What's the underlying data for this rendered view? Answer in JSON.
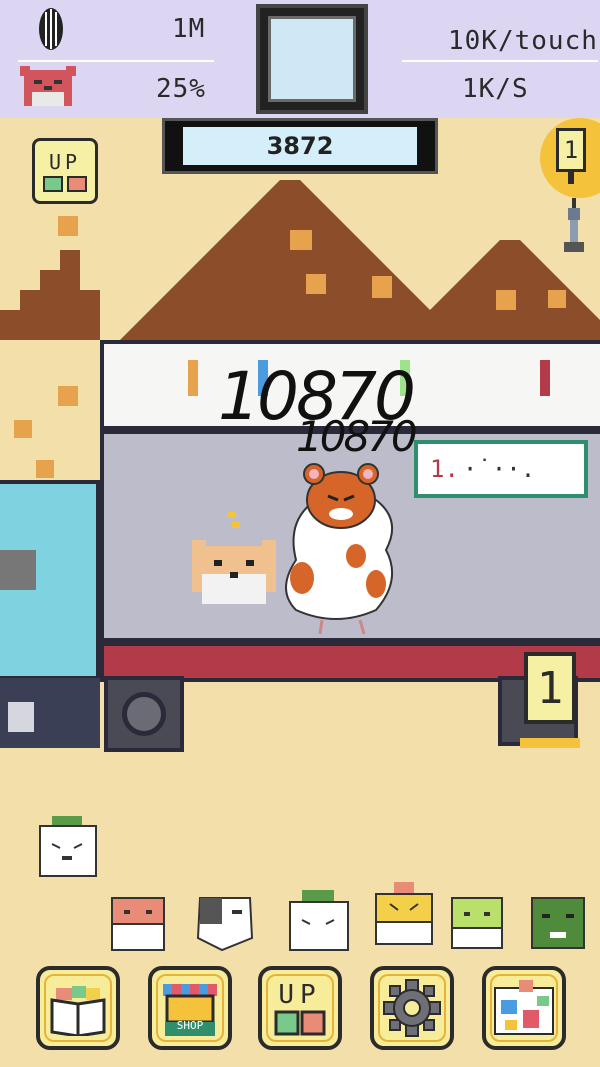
{
  "hud": {
    "seeds": "1M",
    "happiness": "25%",
    "per_touch": "10K/touch",
    "per_second": "1K/S",
    "counter": "3872"
  },
  "scene": {
    "upgrade_label": "UP",
    "level_badge": "1",
    "truck_level": "1",
    "ranking_sign": "1.",
    "floating_text_1": "10870",
    "floating_text_2": "10870"
  },
  "nav": {
    "collection_icon": "book-icon",
    "shop_icon": "shop-icon",
    "shop_label": "SHOP",
    "upgrade_icon": "upgrade-icon",
    "upgrade_label": "UP",
    "settings_icon": "gear-icon",
    "map_icon": "map-icon"
  },
  "colors": {
    "hud_bg": "#dcd6f2",
    "sand": "#f3dfa9",
    "mountain": "#8c4d2b",
    "truck_red": "#b23a49",
    "sign_green": "#2f8f6c",
    "button_yellow": "#f7ec9a"
  }
}
